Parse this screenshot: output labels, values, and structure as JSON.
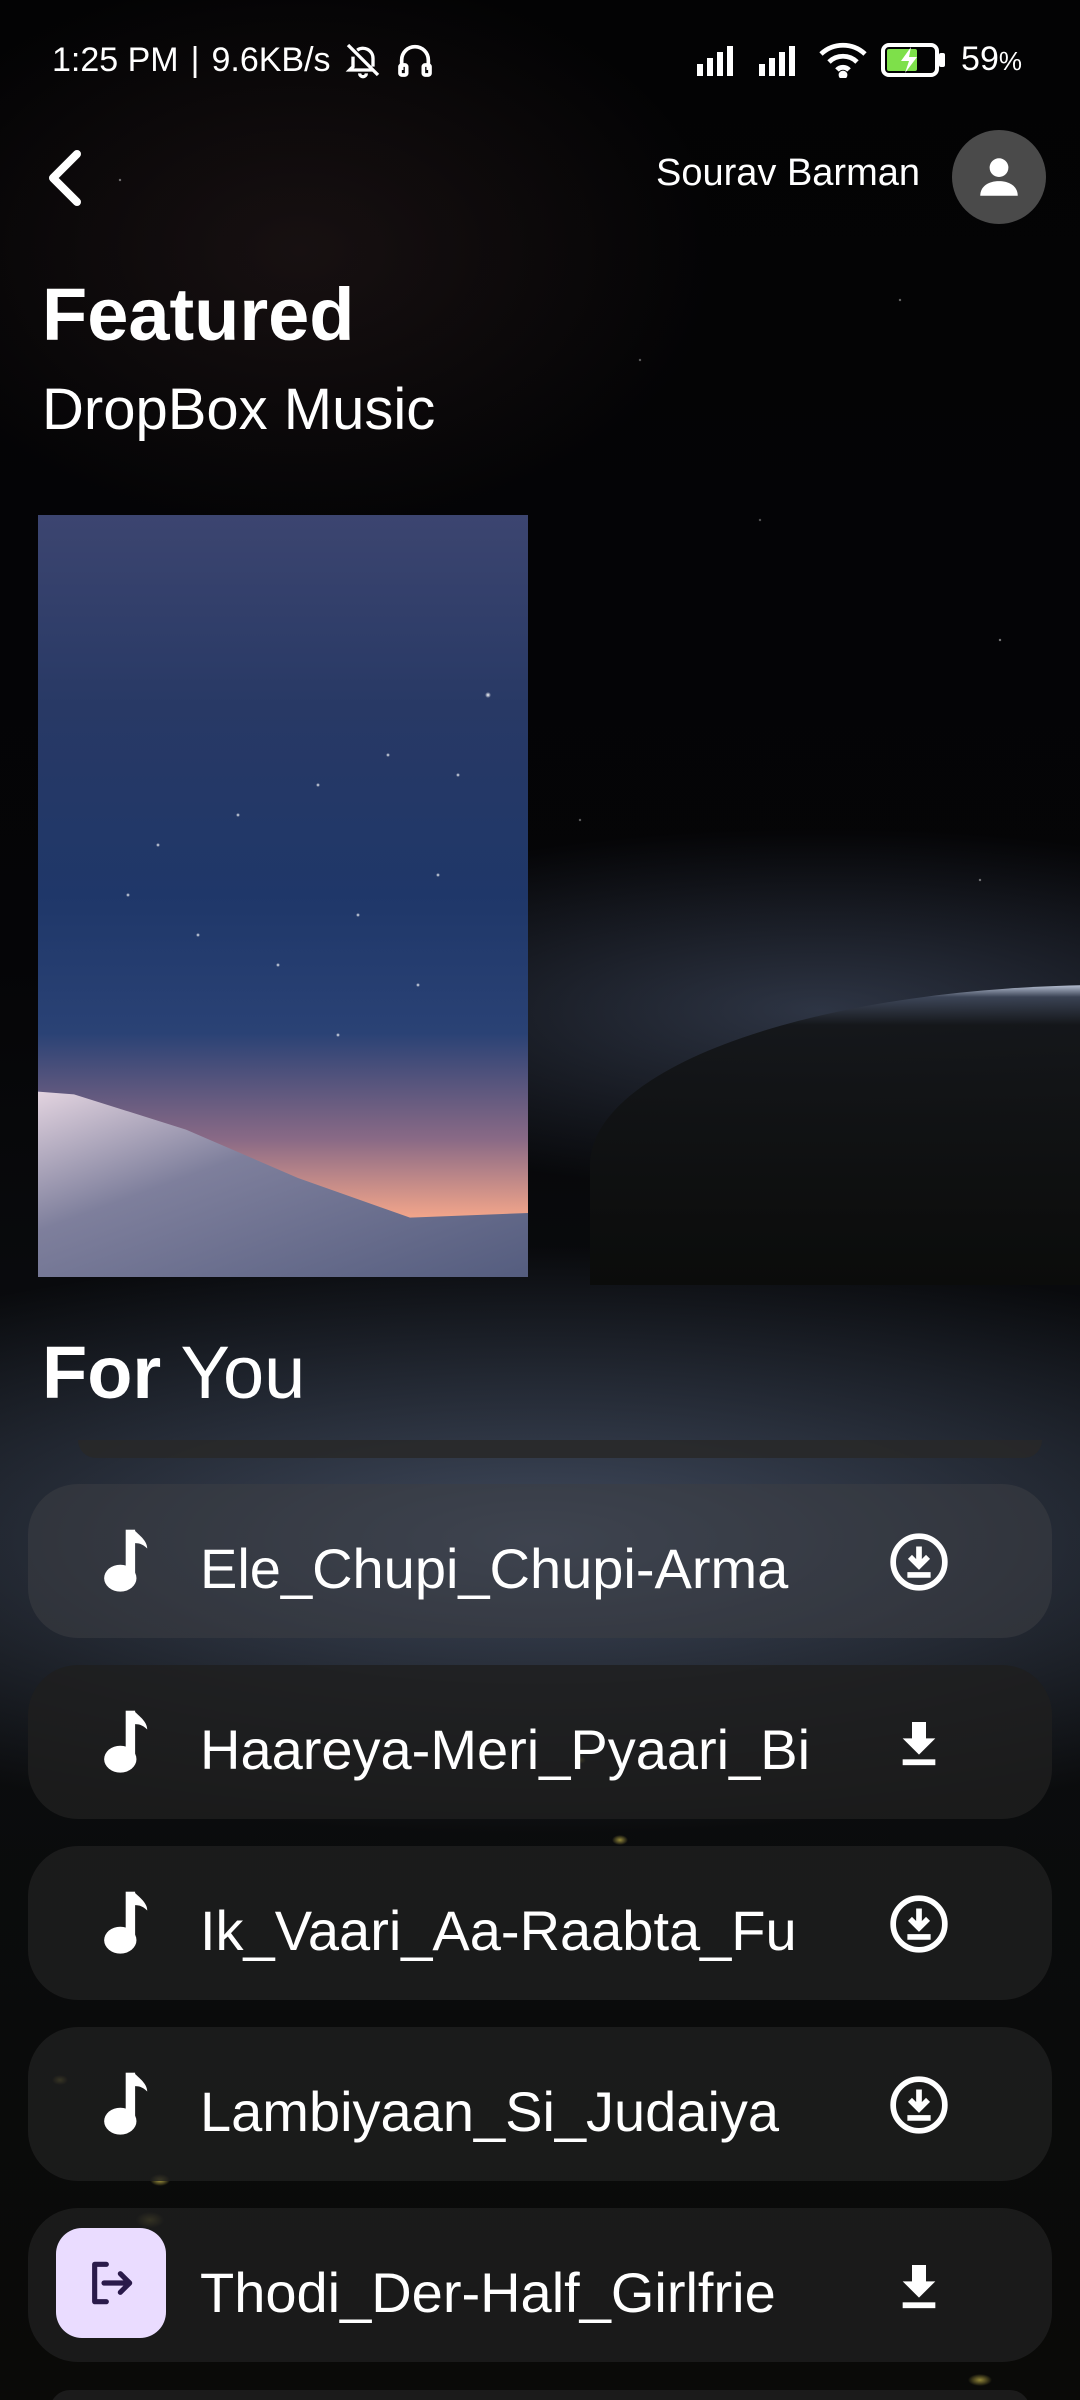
{
  "status_bar": {
    "time": "1:25 PM",
    "separator": "|",
    "speed": "9.6KB/s",
    "battery": "59",
    "battery_unit": "%",
    "icons": [
      "bell-off-icon",
      "headphones-icon",
      "signal-icon",
      "signal-icon",
      "wifi-icon",
      "battery-charging-icon"
    ]
  },
  "header": {
    "back_icon": "chevron-left-icon",
    "user_name": "Sourav Barman",
    "avatar_icon": "person-icon"
  },
  "featured": {
    "title": "Featured",
    "subtitle": "DropBox Music"
  },
  "for_you": {
    "title_bold": "For",
    "title_rest": "You"
  },
  "songs": [
    {
      "title": "Ele_Chupi_Chupi-Arma",
      "action_icon": "download-circle-icon"
    },
    {
      "title": "Haareya-Meri_Pyaari_Bi",
      "action_icon": "download-icon"
    },
    {
      "title": "Ik_Vaari_Aa-Raabta_Fu",
      "action_icon": "download-circle-icon"
    },
    {
      "title": "Lambiyaan_Si_Judaiya",
      "action_icon": "download-circle-icon"
    },
    {
      "title": "Thodi_Der-Half_Girlfrie",
      "action_icon": "download-icon"
    }
  ],
  "fab_icon": "logout-icon",
  "colors": {
    "background": "#000000",
    "row_background": "#1e1e1e",
    "fab_background": "#eadcff",
    "fab_icon": "#2a1a4a",
    "text": "#ffffff"
  }
}
